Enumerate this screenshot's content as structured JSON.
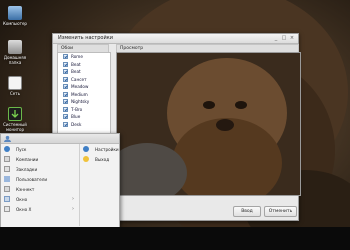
{
  "desktop": {
    "icons": [
      {
        "label": "Компьютер",
        "icon": "computer-icon"
      },
      {
        "label": "Домашняя папка",
        "icon": "home-folder-icon"
      },
      {
        "label": "Сеть",
        "icon": "document-icon"
      },
      {
        "label": "Системный монитор",
        "icon": "download-icon"
      }
    ]
  },
  "dialog": {
    "title": "Изменить настройки",
    "skins_header": "Обои",
    "preview_header": "Просмотр",
    "skins": [
      "Rome",
      "Beat",
      "Beat",
      "Сансет",
      "Meadow",
      "Medium",
      "Nightsky",
      "Т-Bro",
      "Blue",
      "Desk"
    ],
    "apply_label": "Ввод",
    "cancel_label": "Отменить"
  },
  "start_menu": {
    "left_items": [
      {
        "label": "Пуск",
        "icon": "start-icon",
        "submenu": false
      },
      {
        "label": "Компании",
        "icon": "folder-icon",
        "submenu": false
      },
      {
        "label": "Закладки",
        "icon": "bookmark-icon",
        "submenu": false
      },
      {
        "label": "Пользователи",
        "icon": "users-icon",
        "submenu": false
      },
      {
        "label": "Кэннект",
        "icon": "connect-icon",
        "submenu": false
      },
      {
        "label": "Окно",
        "icon": "window-icon",
        "submenu": true
      },
      {
        "label": "Окно Х",
        "icon": "window-x-icon",
        "submenu": true
      }
    ],
    "right_items": [
      {
        "label": "Настройки",
        "icon": "settings-icon"
      },
      {
        "label": "Выход",
        "icon": "logout-icon"
      }
    ]
  },
  "colors": {
    "accent": "#3f7fc6",
    "taskbar": "#0a0a0a",
    "dialog_bg": "#e9e9e9"
  }
}
